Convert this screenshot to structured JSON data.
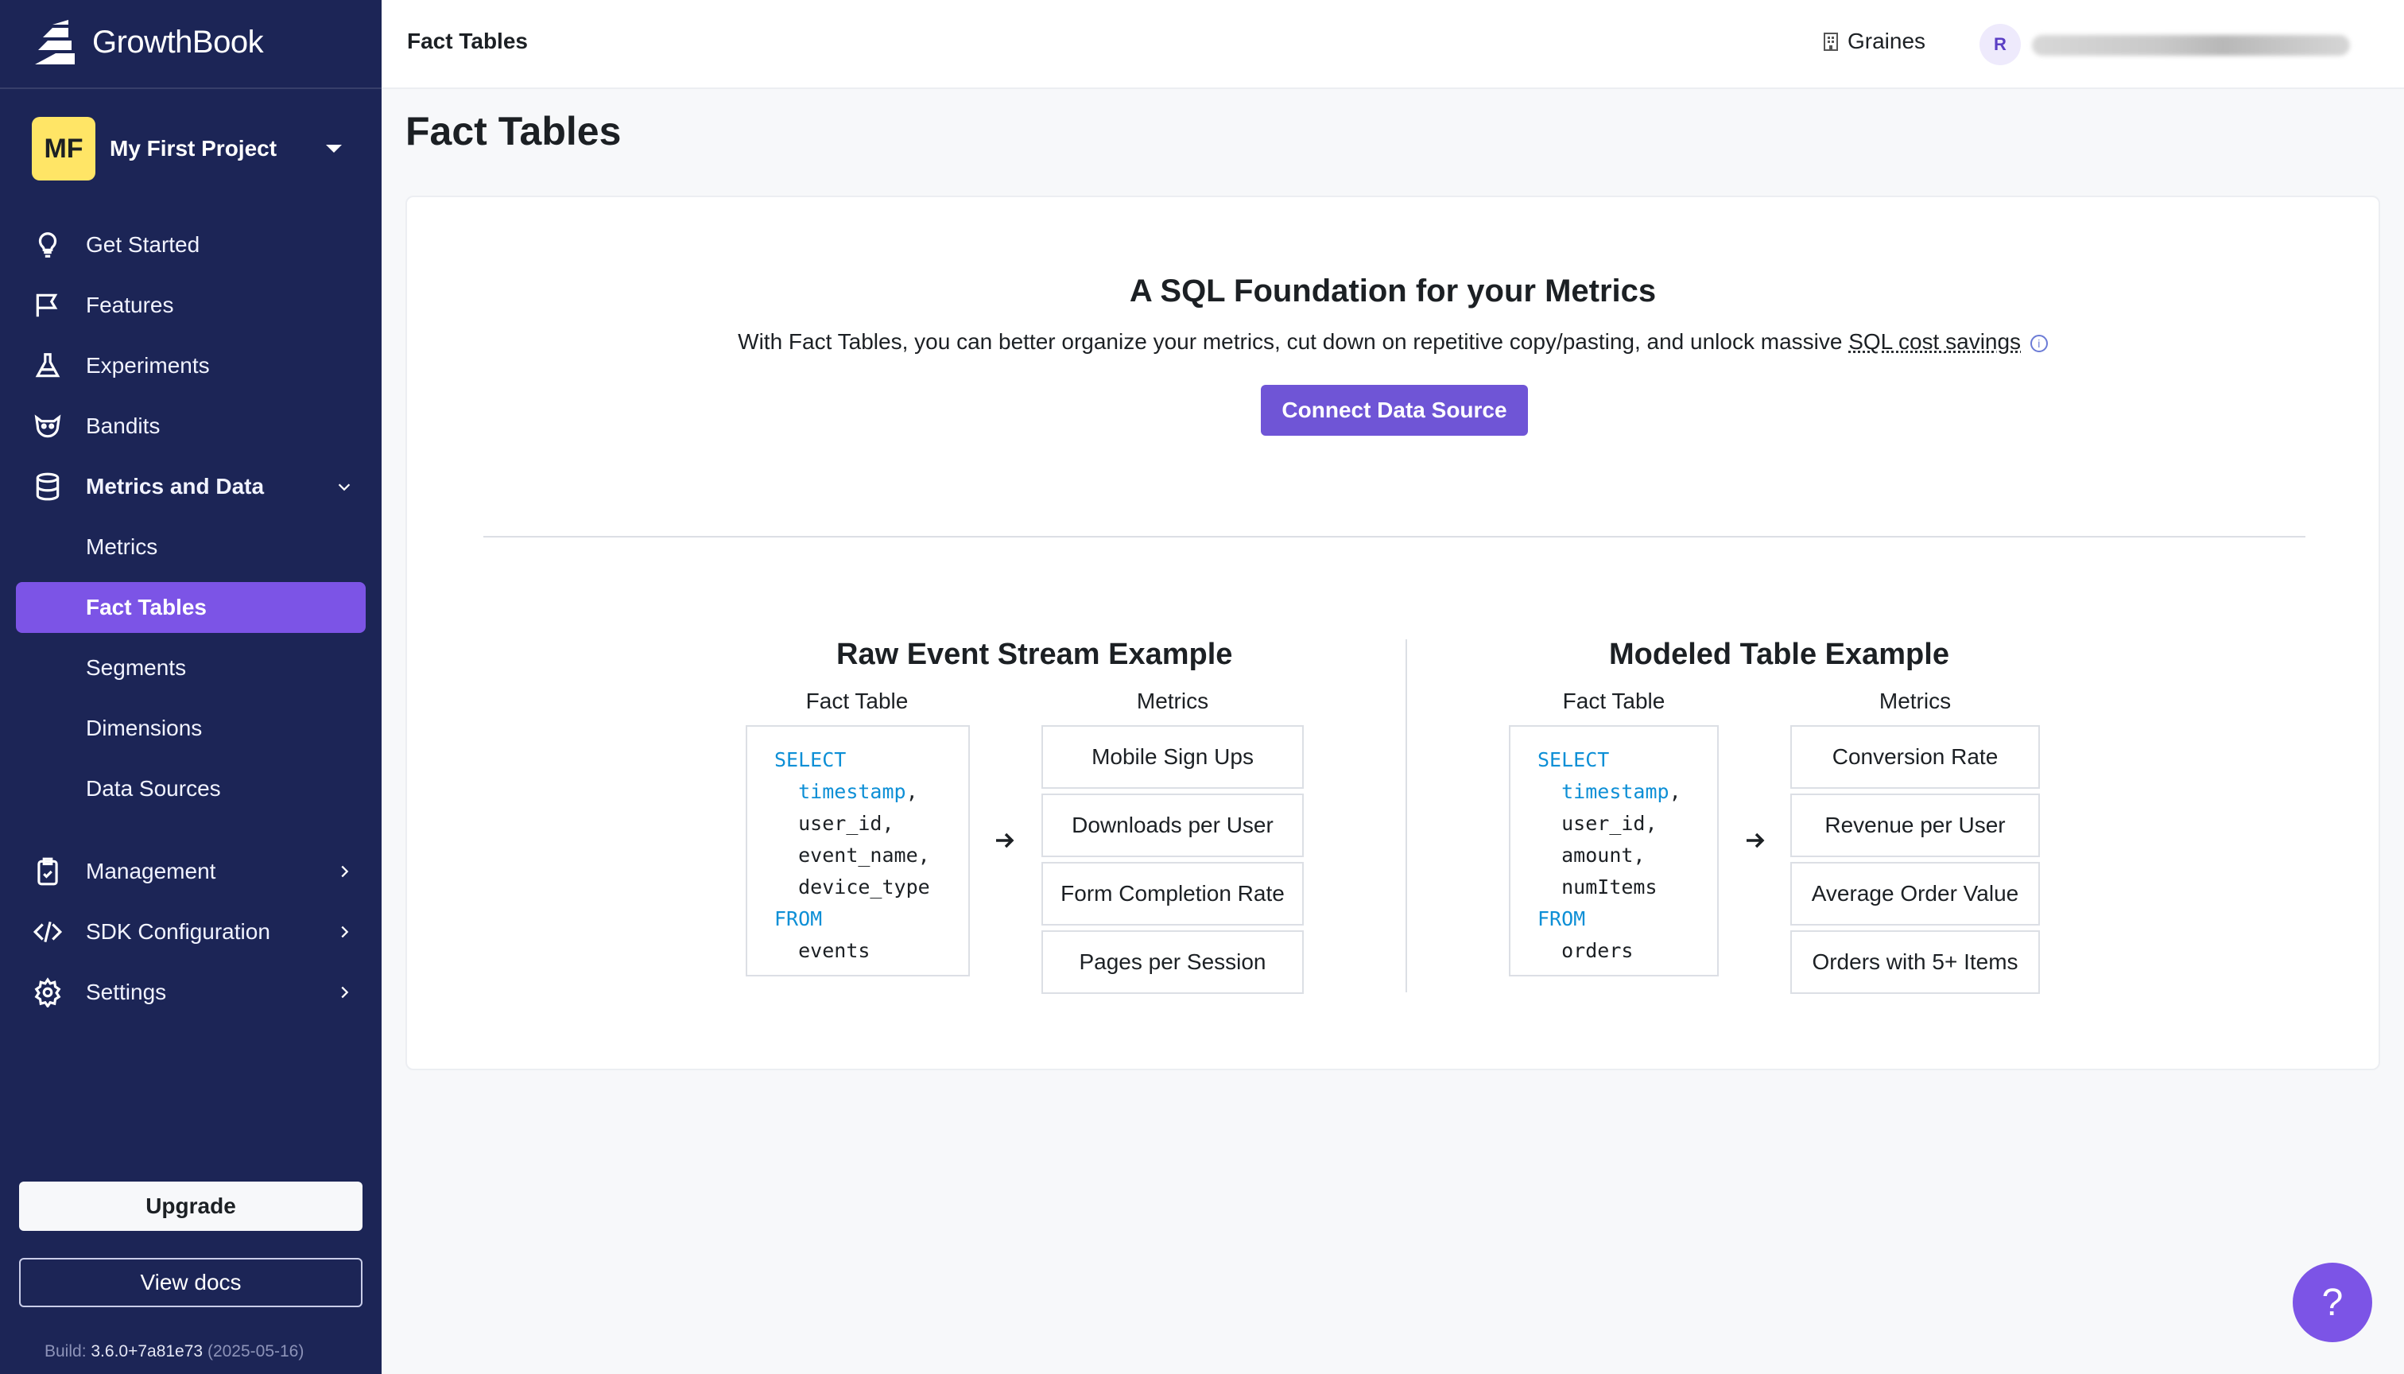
{
  "brand": {
    "name": "GrowthBook"
  },
  "project": {
    "initials": "MF",
    "name": "My First Project"
  },
  "nav": {
    "get_started": "Get Started",
    "features": "Features",
    "experiments": "Experiments",
    "bandits": "Bandits",
    "metrics_and_data": "Metrics and Data",
    "sub": {
      "metrics": "Metrics",
      "fact_tables": "Fact Tables",
      "segments": "Segments",
      "dimensions": "Dimensions",
      "data_sources": "Data Sources"
    },
    "management": "Management",
    "sdk_configuration": "SDK Configuration",
    "settings": "Settings"
  },
  "sidebar_footer": {
    "upgrade": "Upgrade",
    "view_docs": "View docs",
    "build_label": "Build:",
    "build_version": "3.6.0+7a81e73",
    "build_date": "(2025-05-16)"
  },
  "header": {
    "breadcrumb": "Fact Tables",
    "org_name": "Graines",
    "user_initial": "R"
  },
  "main": {
    "title": "Fact Tables",
    "hero_title": "A SQL Foundation for your Metrics",
    "hero_text": "With Fact Tables, you can better organize your metrics, cut down on repetitive copy/pasting, and unlock massive",
    "hero_link": "SQL cost savings",
    "connect_button": "Connect Data Source",
    "raw": {
      "title": "Raw Event Stream Example",
      "fact_table_label": "Fact Table",
      "metrics_label": "Metrics",
      "sql": {
        "select": "SELECT",
        "f1": "timestamp",
        "f2": "user_id,",
        "f3": "event_name,",
        "f4": "device_type",
        "from": "FROM",
        "table": "events"
      },
      "metrics": [
        "Mobile Sign Ups",
        "Downloads per User",
        "Form Completion Rate",
        "Pages per Session"
      ]
    },
    "modeled": {
      "title": "Modeled Table Example",
      "fact_table_label": "Fact Table",
      "metrics_label": "Metrics",
      "sql": {
        "select": "SELECT",
        "f1": "timestamp",
        "f2": "user_id,",
        "f3": "amount,",
        "f4": "numItems",
        "from": "FROM",
        "table": "orders"
      },
      "metrics": [
        "Conversion Rate",
        "Revenue per User",
        "Average Order Value",
        "Orders with 5+ Items"
      ]
    }
  },
  "help_button": "?",
  "colors": {
    "sidebar": "#1c2556",
    "accent": "#7c54e6",
    "button": "#6f55d6",
    "sql_keyword": "#0d8fd6"
  }
}
